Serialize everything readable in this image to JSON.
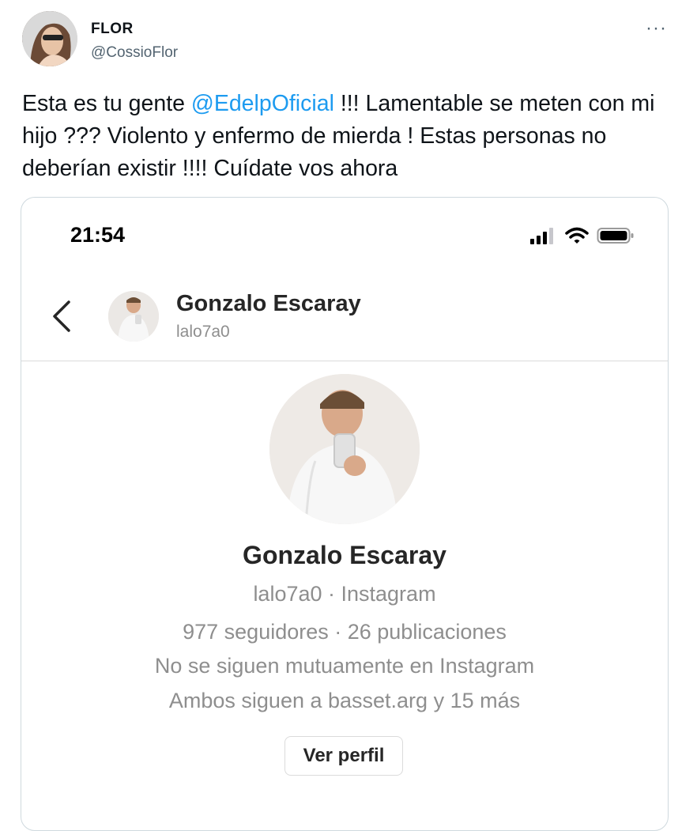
{
  "tweet": {
    "author_name": "FLOR",
    "author_handle": "@CossioFlor",
    "more_label": "···",
    "text_before": "Esta es tu gente ",
    "mention": "@EdelpOficial",
    "text_after": " !!! Lamentable se meten con mi hijo ??? Violento y enfermo de mierda ! Estas personas no deberían existir !!!! Cuídate vos ahora"
  },
  "screenshot": {
    "status_time": "21:54",
    "status_icons": [
      "signal-icon",
      "wifi-icon",
      "battery-icon"
    ],
    "header": {
      "name": "Gonzalo Escaray",
      "username": "lalo7a0"
    },
    "profile": {
      "name": "Gonzalo Escaray",
      "username_line": "lalo7a0 · Instagram",
      "stats_line": "977 seguidores · 26 publicaciones",
      "mutual_line": "No se siguen mutuamente en Instagram",
      "followed_by_line": "Ambos siguen a basset.arg y 15 más",
      "view_profile_label": "Ver perfil"
    }
  },
  "colors": {
    "mention": "#1d9bf0",
    "secondary_text": "#8e8e8e",
    "card_border": "#cfd9de"
  }
}
